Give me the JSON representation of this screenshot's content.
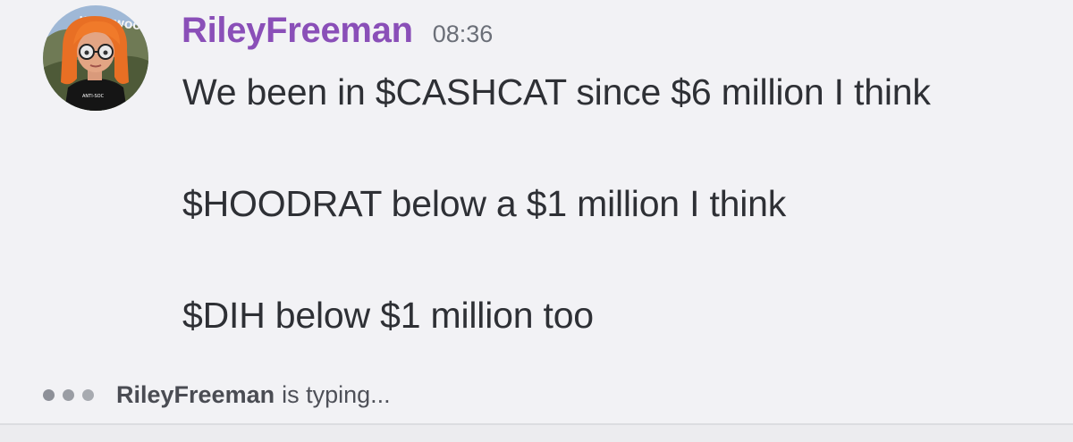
{
  "message": {
    "avatar_icon": "avatar-cartoon-woman-icon",
    "avatar_shirt_text": "ANTI-SOCIAL",
    "avatar_sign_text": "HOLLYWOOD",
    "username": "RileyFreeman",
    "timestamp": "08:36",
    "username_color": "#8a4fb8",
    "lines": [
      "We been in $CASHCAT since $6 million I think",
      "$HOODRAT below a $1 million I think",
      "$DIH below $1 million too"
    ]
  },
  "typing_indicator": {
    "icon": "typing-dots-icon",
    "user": "RileyFreeman",
    "suffix": "is typing..."
  }
}
